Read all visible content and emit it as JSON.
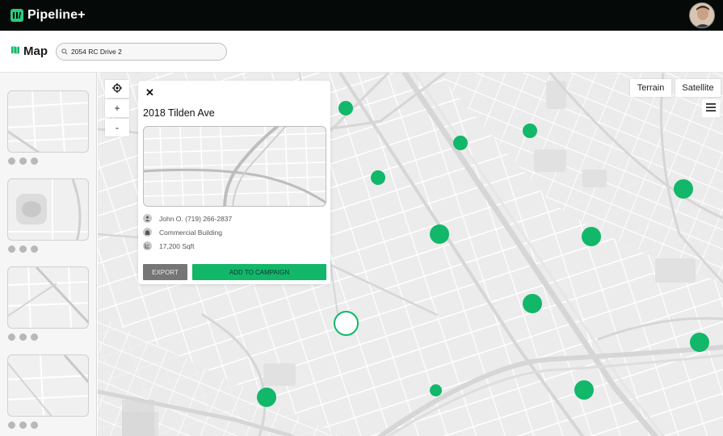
{
  "app": {
    "name": "Pipeline+"
  },
  "colors": {
    "accent": "#12b76a",
    "topbar": "#050a08"
  },
  "header": {
    "title": "Map",
    "search": {
      "value": "2054 RC Drive 2",
      "placeholder": ""
    }
  },
  "map": {
    "layers": {
      "terrain": "Terrain",
      "satellite": "Satellite"
    },
    "controls": {
      "zoom_in": "+",
      "zoom_out": "-"
    }
  },
  "popup": {
    "close": "✕",
    "title": "2018 Tilden Ave",
    "owner": "John O. (719) 266-2837",
    "property_type": "Commercial Building",
    "area": "17,200 Sqft",
    "export_label": "EXPORT",
    "add_label": "ADD TO CAMPAIGN"
  },
  "sidebar": {
    "thumbnails": [
      "property-1",
      "property-2",
      "property-3",
      "property-4"
    ]
  }
}
